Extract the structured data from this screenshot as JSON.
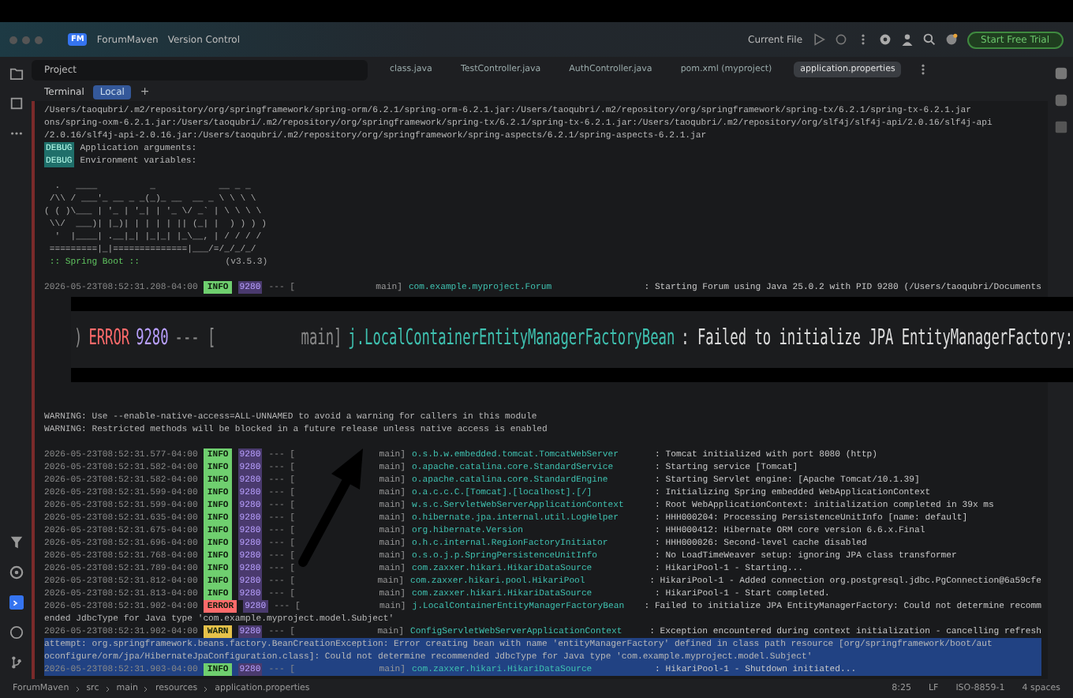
{
  "title_bar": {
    "logo": "FM",
    "project": "ForumMaven",
    "vcs": "Version Control",
    "run_config": "Current File",
    "trial_button": "Start Free Trial"
  },
  "project_panel": {
    "label": "Project"
  },
  "editor_tabs": [
    {
      "label": "class.java",
      "selected": false
    },
    {
      "label": "TestController.java",
      "selected": false
    },
    {
      "label": "AuthController.java",
      "selected": false
    },
    {
      "label": "pom.xml (myproject)",
      "selected": false
    },
    {
      "label": "application.properties",
      "selected": true
    }
  ],
  "terminal": {
    "title": "Terminal",
    "tabs": [
      {
        "label": "Local",
        "selected": true
      }
    ],
    "add": "+",
    "upper_lines": [
      {
        "kind": "text",
        "text": "/Users/taoqubri/.m2/repository/org/springframework/spring-orm/6.2.1/spring-orm-6.2.1.jar:/Users/taoqubri/.m2/repository/org/springframework/spring-tx/6.2.1/spring-tx-6.2.1.jar"
      },
      {
        "kind": "text",
        "text": "ons/spring-oxm-6.2.1.jar:/Users/taoqubri/.m2/repository/org/springframework/spring-tx/6.2.1/spring-tx-6.2.1.jar:/Users/taoqubri/.m2/repository/org/slf4j/slf4j-api/2.0.16/slf4j-api"
      },
      {
        "kind": "text",
        "text": "/2.0.16/slf4j-api-2.0.16.jar:/Users/taoqubri/.m2/repository/org/springframework/spring-aspects/6.2.1/spring-aspects-6.2.1.jar"
      },
      {
        "kind": "badge",
        "badge": "DEBUG",
        "text": "Application arguments:"
      },
      {
        "kind": "badge",
        "badge": "DEBUG",
        "text": "Environment variables:"
      },
      {
        "kind": "blank"
      },
      {
        "kind": "banner",
        "text": "  .   ____          _            __ _ _"
      },
      {
        "kind": "banner",
        "text": " /\\\\ / ___'_ __ _ _(_)_ __  __ _ \\ \\ \\ \\"
      },
      {
        "kind": "banner",
        "text": "( ( )\\___ | '_ | '_| | '_ \\/ _` | \\ \\ \\ \\"
      },
      {
        "kind": "banner",
        "text": " \\\\/  ___)| |_)| | | | | || (_| |  ) ) ) )"
      },
      {
        "kind": "banner",
        "text": "  '  |____| .__|_| |_|_| |_\\__, | / / / /"
      },
      {
        "kind": "banner",
        "text": " =========|_|==============|___/=/_/_/_/"
      },
      {
        "kind": "boot",
        "label": " :: Spring Boot :: ",
        "text": "              (v3.5.3)"
      },
      {
        "kind": "blank"
      },
      {
        "kind": "log",
        "time": "2026-05-23T08:52:31.208-04:00",
        "level": "INFO",
        "color": "#6fcf6f",
        "pid": "9280",
        "sep": "--- [",
        "thread": "main]",
        "logger": "com.example.myproject.Forum",
        "message": ": Starting Forum using Java 25.0.2 with PID 9280 (/Users/taoqubri/Documents",
        "selected": false
      }
    ],
    "lower_lines": [
      {
        "kind": "text",
        "text": "WARNING: Use --enable-native-access=ALL-UNNAMED to avoid a warning for callers in this module"
      },
      {
        "kind": "text",
        "text": "WARNING: Restricted methods will be blocked in a future release unless native access is enabled"
      },
      {
        "kind": "blank"
      },
      {
        "kind": "log",
        "time": "2026-05-23T08:52:31.577-04:00",
        "level": "INFO",
        "color": "#6fcf6f",
        "pid": "9280",
        "sep": "--- [",
        "thread": "main]",
        "logger": "o.s.b.w.embedded.tomcat.TomcatWebServer",
        "message": ": Tomcat initialized with port 8080 (http)",
        "selected": false
      },
      {
        "kind": "log",
        "time": "2026-05-23T08:52:31.582-04:00",
        "level": "INFO",
        "color": "#6fcf6f",
        "pid": "9280",
        "sep": "--- [",
        "thread": "main]",
        "logger": "o.apache.catalina.core.StandardService",
        "message": ": Starting service [Tomcat]",
        "selected": false
      },
      {
        "kind": "log",
        "time": "2026-05-23T08:52:31.582-04:00",
        "level": "INFO",
        "color": "#6fcf6f",
        "pid": "9280",
        "sep": "--- [",
        "thread": "main]",
        "logger": "o.apache.catalina.core.StandardEngine",
        "message": ": Starting Servlet engine: [Apache Tomcat/10.1.39]",
        "selected": false
      },
      {
        "kind": "log",
        "time": "2026-05-23T08:52:31.599-04:00",
        "level": "INFO",
        "color": "#6fcf6f",
        "pid": "9280",
        "sep": "--- [",
        "thread": "main]",
        "logger": "o.a.c.c.C.[Tomcat].[localhost].[/]",
        "message": ": Initializing Spring embedded WebApplicationContext",
        "selected": false
      },
      {
        "kind": "log",
        "time": "2026-05-23T08:52:31.599-04:00",
        "level": "INFO",
        "color": "#6fcf6f",
        "pid": "9280",
        "sep": "--- [",
        "thread": "main]",
        "logger": "w.s.c.ServletWebServerApplicationContext",
        "message": ": Root WebApplicationContext: initialization completed in 39x ms",
        "selected": false
      },
      {
        "kind": "log",
        "time": "2026-05-23T08:52:31.635-04:00",
        "level": "INFO",
        "color": "#6fcf6f",
        "pid": "9280",
        "sep": "--- [",
        "thread": "main]",
        "logger": "o.hibernate.jpa.internal.util.LogHelper",
        "message": ": HHH000204: Processing PersistenceUnitInfo [name: default]",
        "selected": false
      },
      {
        "kind": "log",
        "time": "2026-05-23T08:52:31.675-04:00",
        "level": "INFO",
        "color": "#6fcf6f",
        "pid": "9280",
        "sep": "--- [",
        "thread": "main]",
        "logger": "org.hibernate.Version",
        "message": ": HHH000412: Hibernate ORM core version 6.6.x.Final",
        "selected": false
      },
      {
        "kind": "log",
        "time": "2026-05-23T08:52:31.696-04:00",
        "level": "INFO",
        "color": "#6fcf6f",
        "pid": "9280",
        "sep": "--- [",
        "thread": "main]",
        "logger": "o.h.c.internal.RegionFactoryInitiator",
        "message": ": HHH000026: Second-level cache disabled",
        "selected": false
      },
      {
        "kind": "log",
        "time": "2026-05-23T08:52:31.768-04:00",
        "level": "INFO",
        "color": "#6fcf6f",
        "pid": "9280",
        "sep": "--- [",
        "thread": "main]",
        "logger": "o.s.o.j.p.SpringPersistenceUnitInfo",
        "message": ": No LoadTimeWeaver setup: ignoring JPA class transformer",
        "selected": false
      },
      {
        "kind": "log",
        "time": "2026-05-23T08:52:31.789-04:00",
        "level": "INFO",
        "color": "#6fcf6f",
        "pid": "9280",
        "sep": "--- [",
        "thread": "main]",
        "logger": "com.zaxxer.hikari.HikariDataSource",
        "message": ": HikariPool-1 - Starting...",
        "selected": false
      },
      {
        "kind": "log",
        "time": "2026-05-23T08:52:31.812-04:00",
        "level": "INFO",
        "color": "#6fcf6f",
        "pid": "9280",
        "sep": "--- [",
        "thread": "main]",
        "logger": "com.zaxxer.hikari.pool.HikariPool",
        "message": ": HikariPool-1 - Added connection org.postgresql.jdbc.PgConnection@6a59cfe",
        "selected": false
      },
      {
        "kind": "log",
        "time": "2026-05-23T08:52:31.813-04:00",
        "level": "INFO",
        "color": "#6fcf6f",
        "pid": "9280",
        "sep": "--- [",
        "thread": "main]",
        "logger": "com.zaxxer.hikari.HikariDataSource",
        "message": ": HikariPool-1 - Start completed.",
        "selected": false
      },
      {
        "kind": "log",
        "time": "2026-05-23T08:52:31.902-04:00",
        "level": "ERROR",
        "color": "#ff6b6b",
        "pid": "9280",
        "sep": "--- [",
        "thread": "main]",
        "logger": "j.LocalContainerEntityManagerFactoryBean",
        "message": ": Failed to initialize JPA EntityManagerFactory: Could not determine recomm",
        "selected": false
      },
      {
        "kind": "text",
        "text": "ended JdbcType for Java type 'com.example.myproject.model.Subject'"
      },
      {
        "kind": "log",
        "time": "2026-05-23T08:52:31.902-04:00",
        "level": "WARN",
        "color": "#e6c24a",
        "pid": "9280",
        "sep": "--- [",
        "thread": "main]",
        "logger": "ConfigServletWebServerApplicationContext",
        "message": ": Exception encountered during context initialization - cancelling refresh",
        "selected": false
      },
      {
        "kind": "text",
        "text": "attempt: org.springframework.beans.factory.BeanCreationException: Error creating bean with name 'entityManagerFactory' defined in class path resource [org/springframework/boot/aut",
        "selected": true
      },
      {
        "kind": "text",
        "text": "oconfigure/orm/jpa/HibernateJpaConfiguration.class]: Could not determine recommended JdbcType for Java type 'com.example.myproject.model.Subject'",
        "selected": true
      },
      {
        "kind": "log",
        "time": "2026-05-23T08:52:31.903-04:00",
        "level": "INFO",
        "color": "#6fcf6f",
        "pid": "9280",
        "sep": "--- [",
        "thread": "main]",
        "logger": "com.zaxxer.hikari.HikariDataSource",
        "message": ": HikariPool-1 - Shutdown initiated...",
        "selected": true
      }
    ]
  },
  "callout": {
    "prefix": ")",
    "level": "ERROR",
    "color": "#ff6b6b",
    "pid": "9280",
    "sep": "--- [",
    "thread": "main]",
    "logger": "j.LocalContainerEntityManagerFactoryBean",
    "message": ": Failed to initialize JPA EntityManagerFactory:"
  },
  "breadcrumb": [
    "ForumMaven",
    "src",
    "main",
    "resources",
    "application.properties"
  ],
  "status": [
    "8:25",
    "LF",
    "ISO-8859-1",
    "4 spaces"
  ]
}
